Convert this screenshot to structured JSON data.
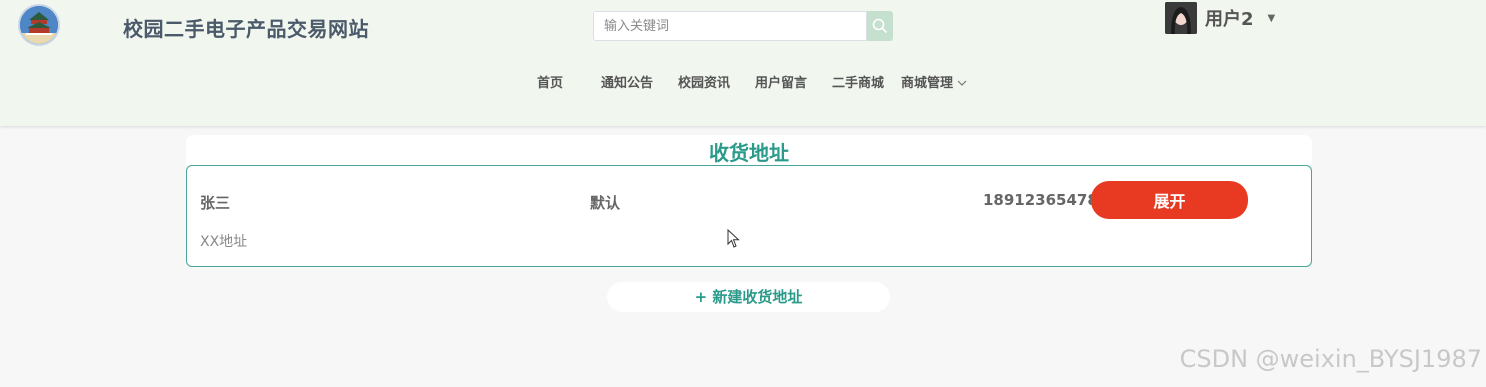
{
  "header": {
    "site_title": "校园二手电子产品交易网站",
    "search": {
      "placeholder": "输入关键词",
      "value": ""
    },
    "user": {
      "name": "用户2"
    },
    "nav": [
      {
        "label": "首页"
      },
      {
        "label": "通知公告"
      },
      {
        "label": "校园资讯"
      },
      {
        "label": "用户留言"
      },
      {
        "label": "二手商城"
      },
      {
        "label": "商城管理",
        "has_dropdown": true
      }
    ]
  },
  "main": {
    "title": "收货地址",
    "address": {
      "name": "张三",
      "default_label": "默认",
      "phone": "18912365478",
      "expand_label": "展开",
      "detail": "XX地址"
    },
    "new_address_label": "+ 新建收货地址"
  },
  "watermark": "CSDN @weixin_BYSJ1987",
  "colors": {
    "accent": "#2a9a8a",
    "expand_button": "#e83a22",
    "header_bg": "#f1f6ee",
    "page_bg": "#f7f7f7"
  }
}
